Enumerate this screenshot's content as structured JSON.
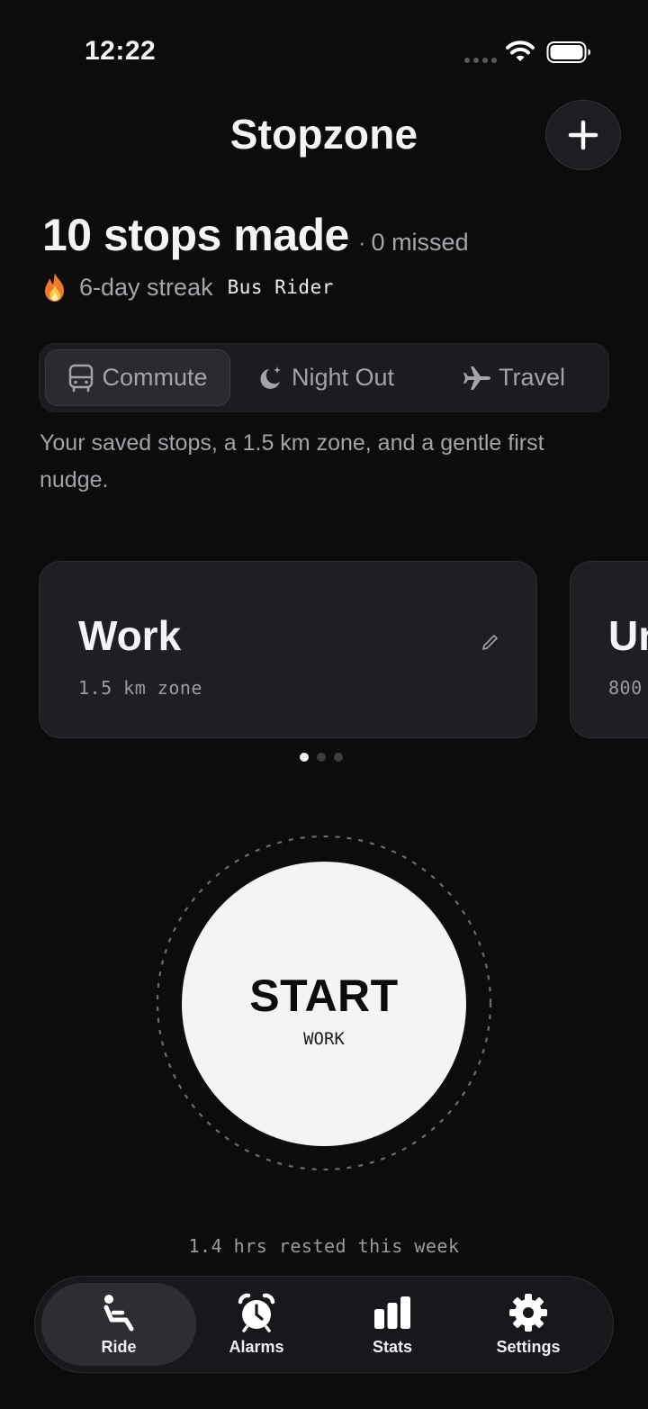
{
  "status": {
    "time": "12:22"
  },
  "header": {
    "title": "Stopzone",
    "add_icon": "plus-icon"
  },
  "stats": {
    "stops_made": "10 stops made",
    "separator": "·",
    "missed": "0 missed",
    "streak": "6-day streak",
    "badge": "Bus Rider"
  },
  "presets": {
    "items": [
      {
        "label": "Commute",
        "icon": "bus-icon",
        "active": true
      },
      {
        "label": "Night Out",
        "icon": "moon-sparkle-icon",
        "active": false
      },
      {
        "label": "Travel",
        "icon": "plane-icon",
        "active": false
      }
    ],
    "description": "Your saved stops, a 1.5 km zone, and a gentle first nudge."
  },
  "cards": [
    {
      "title": "Work",
      "zone": "1.5 km zone"
    },
    {
      "title": "Un",
      "zone": "800"
    }
  ],
  "pagination": {
    "total": 3,
    "active": 1
  },
  "start": {
    "label": "START",
    "destination": "WORK"
  },
  "rest_summary": "1.4 hrs rested this week",
  "tabs": [
    {
      "label": "Ride",
      "icon": "seat-icon",
      "active": true
    },
    {
      "label": "Alarms",
      "icon": "alarm-clock-icon",
      "active": false
    },
    {
      "label": "Stats",
      "icon": "bar-chart-icon",
      "active": false
    },
    {
      "label": "Settings",
      "icon": "gear-icon",
      "active": false
    }
  ],
  "colors": {
    "background": "#0c0c0d",
    "card": "#201e25",
    "start_button": "#f4f3f6",
    "muted_text": "#a4a3aa"
  }
}
